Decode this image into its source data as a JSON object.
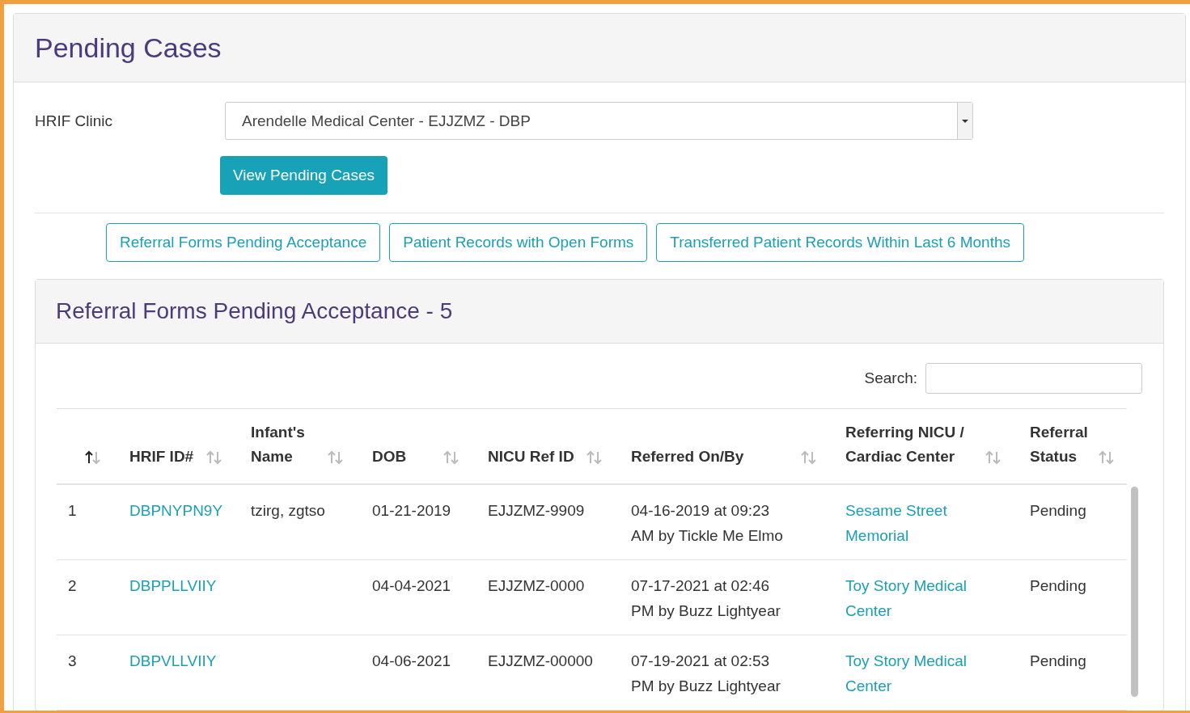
{
  "page": {
    "title": "Pending Cases"
  },
  "clinic": {
    "label": "HRIF Clinic",
    "value": "Arendelle Medical Center - EJJZMZ - DBP"
  },
  "view_button": "View Pending Cases",
  "tabs": [
    {
      "label": "Referral Forms Pending Acceptance"
    },
    {
      "label": "Patient Records with Open Forms"
    },
    {
      "label": "Transferred Patient Records Within Last 6 Months"
    }
  ],
  "section": {
    "title": "Referral Forms Pending Acceptance - 5",
    "search_label": "Search:"
  },
  "table": {
    "columns": [
      {
        "kind": "text",
        "sorted": true
      },
      {
        "label": "HRIF ID#",
        "kind": "link",
        "sorted": false
      },
      {
        "label": "Infant's Name",
        "kind": "text",
        "sorted": false
      },
      {
        "label": "DOB",
        "kind": "text",
        "sorted": false
      },
      {
        "label": "NICU Ref ID",
        "kind": "text",
        "sorted": false
      },
      {
        "label": "Referred On/By",
        "kind": "text",
        "sorted": false
      },
      {
        "label": "Referring NICU / Cardiac Center",
        "kind": "link",
        "sorted": false
      },
      {
        "label": "Referral Status",
        "kind": "text",
        "sorted": false
      }
    ],
    "rows": [
      [
        "1",
        "DBPNYPN9Y",
        "tzirg, zgtso",
        "01-21-2019",
        "EJJZMZ-9909",
        "04-16-2019 at 09:23 AM by Tickle Me Elmo",
        "Sesame Street Memorial",
        "Pending"
      ],
      [
        "2",
        "DBPPLLVIIY",
        "",
        "04-04-2021",
        "EJJZMZ-0000",
        "07-17-2021 at 02:46 PM by Buzz Lightyear",
        "Toy Story Medical Center",
        "Pending"
      ],
      [
        "3",
        "DBPVLLVIIY",
        "",
        "04-06-2021",
        "EJJZMZ-00000",
        "07-19-2021 at 02:53 PM by Buzz Lightyear",
        "Toy Story Medical Center",
        "Pending"
      ]
    ]
  }
}
